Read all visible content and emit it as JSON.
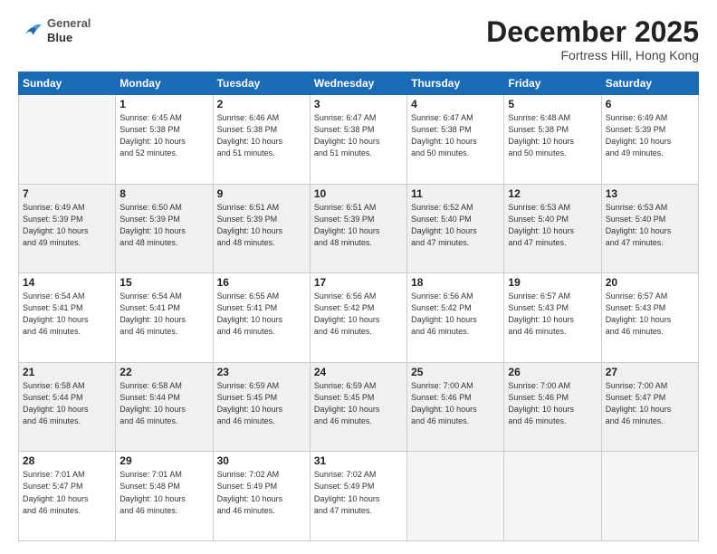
{
  "header": {
    "logo_line1": "General",
    "logo_line2": "Blue",
    "month": "December 2025",
    "location": "Fortress Hill, Hong Kong"
  },
  "weekdays": [
    "Sunday",
    "Monday",
    "Tuesday",
    "Wednesday",
    "Thursday",
    "Friday",
    "Saturday"
  ],
  "weeks": [
    [
      {
        "day": "",
        "info": ""
      },
      {
        "day": "1",
        "info": "Sunrise: 6:45 AM\nSunset: 5:38 PM\nDaylight: 10 hours\nand 52 minutes."
      },
      {
        "day": "2",
        "info": "Sunrise: 6:46 AM\nSunset: 5:38 PM\nDaylight: 10 hours\nand 51 minutes."
      },
      {
        "day": "3",
        "info": "Sunrise: 6:47 AM\nSunset: 5:38 PM\nDaylight: 10 hours\nand 51 minutes."
      },
      {
        "day": "4",
        "info": "Sunrise: 6:47 AM\nSunset: 5:38 PM\nDaylight: 10 hours\nand 50 minutes."
      },
      {
        "day": "5",
        "info": "Sunrise: 6:48 AM\nSunset: 5:38 PM\nDaylight: 10 hours\nand 50 minutes."
      },
      {
        "day": "6",
        "info": "Sunrise: 6:49 AM\nSunset: 5:39 PM\nDaylight: 10 hours\nand 49 minutes."
      }
    ],
    [
      {
        "day": "7",
        "info": "Sunrise: 6:49 AM\nSunset: 5:39 PM\nDaylight: 10 hours\nand 49 minutes."
      },
      {
        "day": "8",
        "info": "Sunrise: 6:50 AM\nSunset: 5:39 PM\nDaylight: 10 hours\nand 48 minutes."
      },
      {
        "day": "9",
        "info": "Sunrise: 6:51 AM\nSunset: 5:39 PM\nDaylight: 10 hours\nand 48 minutes."
      },
      {
        "day": "10",
        "info": "Sunrise: 6:51 AM\nSunset: 5:39 PM\nDaylight: 10 hours\nand 48 minutes."
      },
      {
        "day": "11",
        "info": "Sunrise: 6:52 AM\nSunset: 5:40 PM\nDaylight: 10 hours\nand 47 minutes."
      },
      {
        "day": "12",
        "info": "Sunrise: 6:53 AM\nSunset: 5:40 PM\nDaylight: 10 hours\nand 47 minutes."
      },
      {
        "day": "13",
        "info": "Sunrise: 6:53 AM\nSunset: 5:40 PM\nDaylight: 10 hours\nand 47 minutes."
      }
    ],
    [
      {
        "day": "14",
        "info": "Sunrise: 6:54 AM\nSunset: 5:41 PM\nDaylight: 10 hours\nand 46 minutes."
      },
      {
        "day": "15",
        "info": "Sunrise: 6:54 AM\nSunset: 5:41 PM\nDaylight: 10 hours\nand 46 minutes."
      },
      {
        "day": "16",
        "info": "Sunrise: 6:55 AM\nSunset: 5:41 PM\nDaylight: 10 hours\nand 46 minutes."
      },
      {
        "day": "17",
        "info": "Sunrise: 6:56 AM\nSunset: 5:42 PM\nDaylight: 10 hours\nand 46 minutes."
      },
      {
        "day": "18",
        "info": "Sunrise: 6:56 AM\nSunset: 5:42 PM\nDaylight: 10 hours\nand 46 minutes."
      },
      {
        "day": "19",
        "info": "Sunrise: 6:57 AM\nSunset: 5:43 PM\nDaylight: 10 hours\nand 46 minutes."
      },
      {
        "day": "20",
        "info": "Sunrise: 6:57 AM\nSunset: 5:43 PM\nDaylight: 10 hours\nand 46 minutes."
      }
    ],
    [
      {
        "day": "21",
        "info": "Sunrise: 6:58 AM\nSunset: 5:44 PM\nDaylight: 10 hours\nand 46 minutes."
      },
      {
        "day": "22",
        "info": "Sunrise: 6:58 AM\nSunset: 5:44 PM\nDaylight: 10 hours\nand 46 minutes."
      },
      {
        "day": "23",
        "info": "Sunrise: 6:59 AM\nSunset: 5:45 PM\nDaylight: 10 hours\nand 46 minutes."
      },
      {
        "day": "24",
        "info": "Sunrise: 6:59 AM\nSunset: 5:45 PM\nDaylight: 10 hours\nand 46 minutes."
      },
      {
        "day": "25",
        "info": "Sunrise: 7:00 AM\nSunset: 5:46 PM\nDaylight: 10 hours\nand 46 minutes."
      },
      {
        "day": "26",
        "info": "Sunrise: 7:00 AM\nSunset: 5:46 PM\nDaylight: 10 hours\nand 46 minutes."
      },
      {
        "day": "27",
        "info": "Sunrise: 7:00 AM\nSunset: 5:47 PM\nDaylight: 10 hours\nand 46 minutes."
      }
    ],
    [
      {
        "day": "28",
        "info": "Sunrise: 7:01 AM\nSunset: 5:47 PM\nDaylight: 10 hours\nand 46 minutes."
      },
      {
        "day": "29",
        "info": "Sunrise: 7:01 AM\nSunset: 5:48 PM\nDaylight: 10 hours\nand 46 minutes."
      },
      {
        "day": "30",
        "info": "Sunrise: 7:02 AM\nSunset: 5:49 PM\nDaylight: 10 hours\nand 46 minutes."
      },
      {
        "day": "31",
        "info": "Sunrise: 7:02 AM\nSunset: 5:49 PM\nDaylight: 10 hours\nand 47 minutes."
      },
      {
        "day": "",
        "info": ""
      },
      {
        "day": "",
        "info": ""
      },
      {
        "day": "",
        "info": ""
      }
    ]
  ]
}
